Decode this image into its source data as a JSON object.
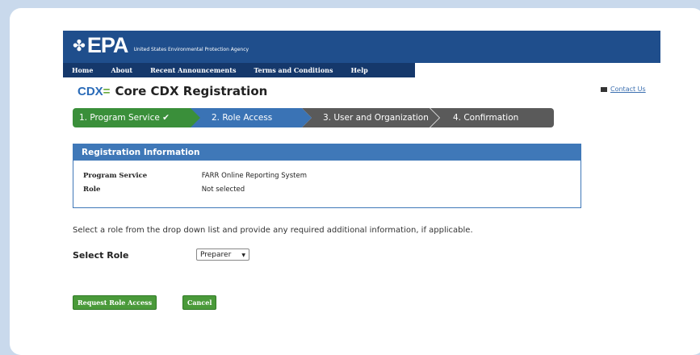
{
  "logo": {
    "mark": "✤",
    "name": "EPA",
    "subtitle": "United States Environmental Protection Agency"
  },
  "nav": {
    "items": [
      "Home",
      "About",
      "Recent Announcements",
      "Terms and Conditions",
      "Help"
    ]
  },
  "page": {
    "cdx_logo": "CDX",
    "cdx_dash": "=",
    "title": "Core CDX Registration",
    "contact_label": "Contact Us"
  },
  "steps": [
    {
      "label": "1. Program Service ✔",
      "state": "complete"
    },
    {
      "label": "2. Role Access",
      "state": "active"
    },
    {
      "label": "3. User and Organization",
      "state": "pending"
    },
    {
      "label": "4. Confirmation",
      "state": "pending"
    }
  ],
  "registration": {
    "header": "Registration Information",
    "rows": [
      {
        "label": "Program Service",
        "value": "FARR Online Reporting System"
      },
      {
        "label": "Role",
        "value": "Not selected"
      }
    ]
  },
  "form": {
    "instruction": "Select a role from the drop down list and provide any required additional information, if applicable.",
    "role_label": "Select Role",
    "role_value": "Preparer",
    "submit_label": "Request Role Access",
    "cancel_label": "Cancel"
  },
  "colors": {
    "header_blue": "#1f4e8c",
    "step_complete": "#3a8f3a",
    "step_active": "#3a73b5",
    "step_pending": "#5a5a5a",
    "button_green": "#4a9a3a"
  }
}
